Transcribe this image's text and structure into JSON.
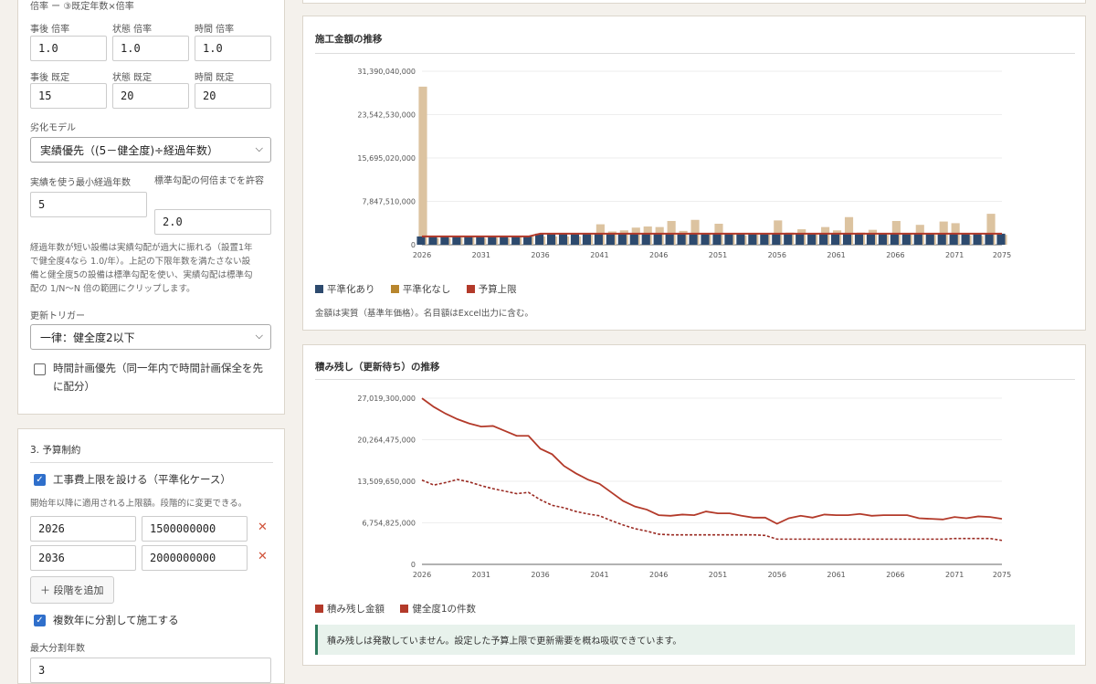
{
  "panel": {
    "cut_header": "倍率 ー ③既定年数×倍率",
    "fields": [
      {
        "label": "事後 倍率",
        "value": "1.0"
      },
      {
        "label": "状態 倍率",
        "value": "1.0"
      },
      {
        "label": "時間 倍率",
        "value": "1.0"
      },
      {
        "label": "事後 既定",
        "value": "15"
      },
      {
        "label": "状態 既定",
        "value": "20"
      },
      {
        "label": "時間 既定",
        "value": "20"
      }
    ],
    "deg_model_label": "劣化モデル",
    "deg_model_value": "実績優先（(5－健全度)÷経過年数）",
    "min_years_label": "実績を使う最小経過年数",
    "min_years_value": "5",
    "multiple_label": "標準勾配の何倍までを許容",
    "multiple_value": "2.0",
    "note": [
      "経過年数が短い設備は実績勾配が過大に振れる（設置1年",
      "で健全度4なら 1.0/年）。上記の下限年数を満たさない設",
      "備と健全度5の設備は標準勾配を使い、実績勾配は標準勾",
      "配の 1/N〜N 倍の範囲にクリップします。"
    ],
    "trigger_label": "更新トリガー",
    "trigger_value": "一律：健全度2以下",
    "time_priority_label": [
      "時間計画優先（同一年内で時間計画保全を先",
      "に配分）"
    ]
  },
  "budget": {
    "title": "3. 予算制約",
    "cap_label": "工事費上限を設ける（平準化ケース）",
    "cap_note": "開始年以降に適用される上限額。段階的に変更できる。",
    "rows": [
      {
        "year": "2026",
        "amount": "1500000000"
      },
      {
        "year": "2036",
        "amount": "2000000000"
      }
    ],
    "remove_icon": "✕",
    "add_label": "＋ 段階を追加",
    "split_label": "複数年に分割して施工する",
    "max_split_label": "最大分割年数",
    "max_split_value": "3"
  },
  "colors": {
    "navy": "#2d4a6e",
    "tan": "#dcc3a0",
    "red": "#b33a2a",
    "gold": "#b8862e"
  },
  "chart_data": [
    {
      "type": "bar",
      "title": "施工金額の推移",
      "ylim": [
        0,
        31390040000
      ],
      "yticks": [
        "0",
        "7,847,510,000",
        "15,695,020,000",
        "23,542,530,000",
        "31,390,040,000"
      ],
      "xticks": [
        "2026",
        "2031",
        "2036",
        "2041",
        "2046",
        "2051",
        "2056",
        "2061",
        "2066",
        "2071",
        "2075"
      ],
      "years": [
        2026,
        2027,
        2028,
        2029,
        2030,
        2031,
        2032,
        2033,
        2034,
        2035,
        2036,
        2037,
        2038,
        2039,
        2040,
        2041,
        2042,
        2043,
        2044,
        2045,
        2046,
        2047,
        2048,
        2049,
        2050,
        2051,
        2052,
        2053,
        2054,
        2055,
        2056,
        2057,
        2058,
        2059,
        2060,
        2061,
        2062,
        2063,
        2064,
        2065,
        2066,
        2067,
        2068,
        2069,
        2070,
        2071,
        2072,
        2073,
        2074,
        2075
      ],
      "series": [
        {
          "name": "平準化あり",
          "values": [
            1500000000,
            1500000000,
            1500000000,
            1500000000,
            1500000000,
            1500000000,
            1500000000,
            1500000000,
            1500000000,
            1500000000,
            2000000000,
            2000000000,
            2000000000,
            2000000000,
            2000000000,
            2000000000,
            2000000000,
            2000000000,
            2000000000,
            2000000000,
            2000000000,
            2000000000,
            2000000000,
            2000000000,
            2000000000,
            2000000000,
            2000000000,
            2000000000,
            2000000000,
            2000000000,
            2000000000,
            2000000000,
            2000000000,
            2000000000,
            2000000000,
            2000000000,
            2000000000,
            2000000000,
            2000000000,
            2000000000,
            2000000000,
            2000000000,
            2000000000,
            2000000000,
            2000000000,
            2000000000,
            2000000000,
            2000000000,
            2000000000,
            2000000000
          ]
        },
        {
          "name": "平準化なし",
          "values": [
            28600000000,
            1200000000,
            1200000000,
            1300000000,
            1400000000,
            1200000000,
            1300000000,
            1200000000,
            1400000000,
            1600000000,
            1500000000,
            1500000000,
            1500000000,
            1500000000,
            1800000000,
            3700000000,
            2400000000,
            2600000000,
            3100000000,
            3300000000,
            3200000000,
            4300000000,
            2500000000,
            4500000000,
            2000000000,
            3800000000,
            1900000000,
            1700000000,
            1900000000,
            2100000000,
            4400000000,
            2200000000,
            2800000000,
            2000000000,
            3200000000,
            2600000000,
            5000000000,
            2200000000,
            2700000000,
            1800000000,
            4300000000,
            2100000000,
            3600000000,
            1800000000,
            4200000000,
            3900000000,
            1700000000,
            1600000000,
            5600000000,
            1800000000
          ]
        },
        {
          "name": "予算上限",
          "values": [
            1500000000,
            1500000000,
            1500000000,
            1500000000,
            1500000000,
            1500000000,
            1500000000,
            1500000000,
            1500000000,
            1500000000,
            2000000000,
            2000000000,
            2000000000,
            2000000000,
            2000000000,
            2000000000,
            2000000000,
            2000000000,
            2000000000,
            2000000000,
            2000000000,
            2000000000,
            2000000000,
            2000000000,
            2000000000,
            2000000000,
            2000000000,
            2000000000,
            2000000000,
            2000000000,
            2000000000,
            2000000000,
            2000000000,
            2000000000,
            2000000000,
            2000000000,
            2000000000,
            2000000000,
            2000000000,
            2000000000,
            2000000000,
            2000000000,
            2000000000,
            2000000000,
            2000000000,
            2000000000,
            2000000000,
            2000000000,
            2000000000,
            2000000000
          ]
        }
      ],
      "caption": "金額は実質（基準年価格）。名目額はExcel出力に含む。"
    },
    {
      "type": "line",
      "title": "積み残し（更新待ち）の推移",
      "ylim": [
        0,
        27019300000
      ],
      "yticks": [
        "0",
        "6,754,825,000",
        "13,509,650,000",
        "20,264,475,000",
        "27,019,300,000"
      ],
      "xticks": [
        "2026",
        "2031",
        "2036",
        "2041",
        "2046",
        "2051",
        "2056",
        "2061",
        "2066",
        "2071",
        "2075"
      ],
      "years": [
        2026,
        2027,
        2028,
        2029,
        2030,
        2031,
        2032,
        2033,
        2034,
        2035,
        2036,
        2037,
        2038,
        2039,
        2040,
        2041,
        2042,
        2043,
        2044,
        2045,
        2046,
        2047,
        2048,
        2049,
        2050,
        2051,
        2052,
        2053,
        2054,
        2055,
        2056,
        2057,
        2058,
        2059,
        2060,
        2061,
        2062,
        2063,
        2064,
        2065,
        2066,
        2067,
        2068,
        2069,
        2070,
        2071,
        2072,
        2073,
        2074,
        2075
      ],
      "series": [
        {
          "name": "積み残し金額",
          "values": [
            27000000000,
            25600000000,
            24500000000,
            23600000000,
            22900000000,
            22400000000,
            22500000000,
            21700000000,
            20900000000,
            20900000000,
            18800000000,
            17900000000,
            16000000000,
            14800000000,
            13800000000,
            13100000000,
            11700000000,
            10300000000,
            9400000000,
            8900000000,
            8000000000,
            7900000000,
            8100000000,
            8000000000,
            8600000000,
            8300000000,
            8300000000,
            7900000000,
            7600000000,
            7600000000,
            6600000000,
            7500000000,
            7900000000,
            7600000000,
            8100000000,
            8000000000,
            8000000000,
            8200000000,
            7900000000,
            8000000000,
            8000000000,
            8000000000,
            7500000000,
            7400000000,
            7300000000,
            7700000000,
            7500000000,
            7800000000,
            7700000000,
            7400000000
          ]
        },
        {
          "name": "健全度1の件数",
          "values": [
            13700000000,
            12900000000,
            13300000000,
            13800000000,
            13400000000,
            12800000000,
            12300000000,
            11900000000,
            11500000000,
            11700000000,
            10500000000,
            9600000000,
            9200000000,
            8600000000,
            8200000000,
            7900000000,
            7100000000,
            6400000000,
            5800000000,
            5400000000,
            4900000000,
            4800000000,
            4800000000,
            4800000000,
            4800000000,
            4800000000,
            4800000000,
            4800000000,
            4800000000,
            4700000000,
            4100000000,
            4100000000,
            4100000000,
            4100000000,
            4100000000,
            4100000000,
            4100000000,
            4100000000,
            4100000000,
            4100000000,
            4100000000,
            4100000000,
            4100000000,
            4100000000,
            4100000000,
            4200000000,
            4200000000,
            4200000000,
            4200000000,
            3900000000
          ]
        }
      ],
      "alert": "積み残しは発散していません。設定した予算上限で更新需要を概ね吸収できています。"
    }
  ]
}
